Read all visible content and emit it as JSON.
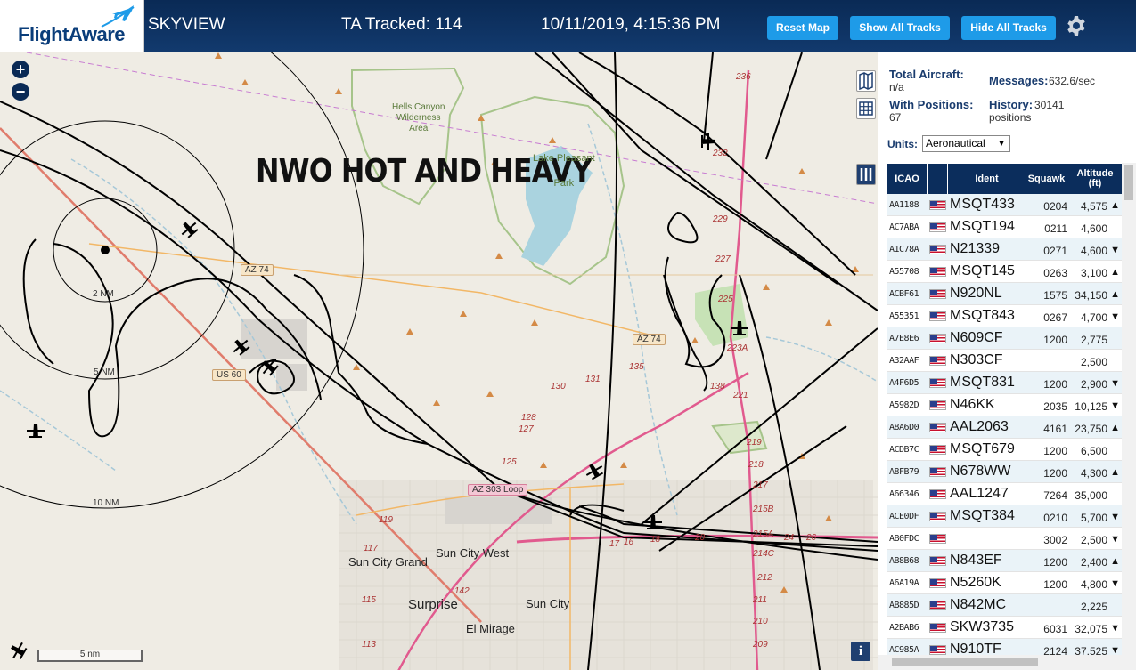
{
  "header": {
    "logo_text": "FlightAware",
    "site_name": "SKYVIEW",
    "tracked": "TA Tracked: 114",
    "datetime": "10/11/2019, 4:15:36 PM",
    "reset_map": "Reset Map",
    "show_all": "Show All Tracks",
    "hide_all": "Hide All Tracks"
  },
  "map": {
    "overlay_title": "NWO HOT AND HEAVY",
    "zoom_in": "+",
    "zoom_out": "−",
    "info": "i",
    "scale_label": "5 nm",
    "range_labels": [
      "2 NM",
      "5 NM",
      "10 NM"
    ],
    "places": {
      "hells_canyon": "Hells Canyon\nWilderness\nArea",
      "lake_park": "Lake Pleasant\nPark",
      "sun_city_grand": "Sun City Grand",
      "sun_city_west": "Sun City West",
      "surprise": "Surprise",
      "sun_city": "Sun City",
      "el_mirage": "El Mirage"
    },
    "shields": {
      "az74_a": "AZ 74",
      "az74_b": "AZ 74",
      "us60": "US 60",
      "loop303": "AZ 303 Loop"
    },
    "road_numbers": [
      "236",
      "232",
      "229",
      "227",
      "225",
      "223A",
      "221",
      "219",
      "218",
      "217",
      "215B",
      "215A",
      "214C",
      "212",
      "211",
      "210",
      "209",
      "131",
      "128",
      "127",
      "125",
      "130",
      "135",
      "138",
      "119",
      "117",
      "115",
      "113",
      "142",
      "24",
      "26",
      "20",
      "18",
      "16",
      "17"
    ]
  },
  "stats": {
    "total_label": "Total Aircraft:",
    "total_value": "n/a",
    "positions_label": "With Positions:",
    "positions_value": "67",
    "messages_label": "Messages:",
    "messages_value": "632.6/sec",
    "history_label": "History:",
    "history_value": "30141",
    "history_unit": "positions",
    "units_label": "Units:",
    "units_value": "Aeronautical"
  },
  "table": {
    "headers": {
      "icao": "ICAO",
      "ident": "Ident",
      "squawk": "Squawk",
      "altitude": "Altitude\n(ft)"
    },
    "rows": [
      {
        "icao": "AA1188",
        "ident": "MSQT433",
        "squawk": "0204",
        "alt": "4,575",
        "trend": "▲"
      },
      {
        "icao": "AC7ABA",
        "ident": "MSQT194",
        "squawk": "0211",
        "alt": "4,600",
        "trend": ""
      },
      {
        "icao": "A1C78A",
        "ident": "N21339",
        "squawk": "0271",
        "alt": "4,600",
        "trend": "▼"
      },
      {
        "icao": "A55708",
        "ident": "MSQT145",
        "squawk": "0263",
        "alt": "3,100",
        "trend": "▲"
      },
      {
        "icao": "ACBF61",
        "ident": "N920NL",
        "squawk": "1575",
        "alt": "34,150",
        "trend": "▲"
      },
      {
        "icao": "A55351",
        "ident": "MSQT843",
        "squawk": "0267",
        "alt": "4,700",
        "trend": "▼"
      },
      {
        "icao": "A7E8E6",
        "ident": "N609CF",
        "squawk": "1200",
        "alt": "2,775",
        "trend": ""
      },
      {
        "icao": "A32AAF",
        "ident": "N303CF",
        "squawk": "",
        "alt": "2,500",
        "trend": ""
      },
      {
        "icao": "A4F6D5",
        "ident": "MSQT831",
        "squawk": "1200",
        "alt": "2,900",
        "trend": "▼"
      },
      {
        "icao": "A5982D",
        "ident": "N46KK",
        "squawk": "2035",
        "alt": "10,125",
        "trend": "▼"
      },
      {
        "icao": "A8A6D0",
        "ident": "AAL2063",
        "squawk": "4161",
        "alt": "23,750",
        "trend": "▲"
      },
      {
        "icao": "ACDB7C",
        "ident": "MSQT679",
        "squawk": "1200",
        "alt": "6,500",
        "trend": ""
      },
      {
        "icao": "A8FB79",
        "ident": "N678WW",
        "squawk": "1200",
        "alt": "4,300",
        "trend": "▲"
      },
      {
        "icao": "A66346",
        "ident": "AAL1247",
        "squawk": "7264",
        "alt": "35,000",
        "trend": ""
      },
      {
        "icao": "ACE0DF",
        "ident": "MSQT384",
        "squawk": "0210",
        "alt": "5,700",
        "trend": "▼"
      },
      {
        "icao": "AB0FDC",
        "ident": "",
        "squawk": "3002",
        "alt": "2,500",
        "trend": "▼"
      },
      {
        "icao": "AB8B68",
        "ident": "N843EF",
        "squawk": "1200",
        "alt": "2,400",
        "trend": "▲"
      },
      {
        "icao": "A6A19A",
        "ident": "N5260K",
        "squawk": "1200",
        "alt": "4,800",
        "trend": "▼"
      },
      {
        "icao": "AB885D",
        "ident": "N842MC",
        "squawk": "",
        "alt": "2,225",
        "trend": ""
      },
      {
        "icao": "A2BAB6",
        "ident": "SKW3735",
        "squawk": "6031",
        "alt": "32,075",
        "trend": "▼"
      },
      {
        "icao": "AC985A",
        "ident": "N910TF",
        "squawk": "2124",
        "alt": "37,525",
        "trend": "▼"
      }
    ]
  },
  "colors": {
    "header_bg": "#0a2a55",
    "button": "#1e9be8",
    "table_head": "#0b2d5c",
    "map_bg": "#efece4",
    "lake": "#aad3df",
    "track": "#000000"
  }
}
